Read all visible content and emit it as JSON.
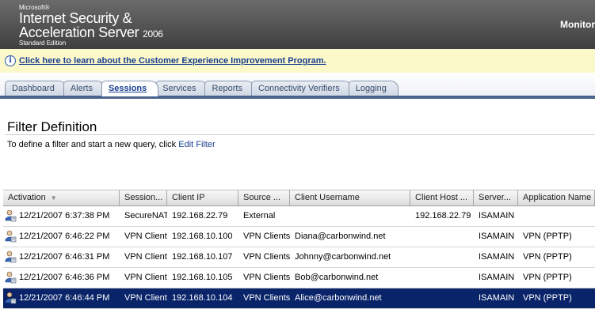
{
  "header": {
    "ms": "Microsoft®",
    "line1": "Internet Security &",
    "line2": "Acceleration Server",
    "year": "2006",
    "edition": "Standard Edition",
    "section": "Monitor"
  },
  "infobar": {
    "icon": "info-icon",
    "link": "Click here to learn about the Customer Experience Improvement Program."
  },
  "tabs": [
    {
      "label": "Dashboard",
      "active": false
    },
    {
      "label": "Alerts",
      "active": false
    },
    {
      "label": "Sessions",
      "active": true
    },
    {
      "label": "Services",
      "active": false
    },
    {
      "label": "Reports",
      "active": false
    },
    {
      "label": "Connectivity Verifiers",
      "active": false
    },
    {
      "label": "Logging",
      "active": false
    }
  ],
  "filter": {
    "title": "Filter Definition",
    "desc": "To define a filter and start a new query, click ",
    "link": "Edit Filter"
  },
  "table": {
    "columns": [
      "Activation",
      "Session...",
      "Client IP",
      "Source ...",
      "Client Username",
      "Client Host ...",
      "Server...",
      "Application Name"
    ],
    "rows": [
      {
        "selected": false,
        "cells": [
          "12/21/2007 6:37:38 PM",
          "SecureNAT",
          "192.168.22.79",
          "External",
          "",
          "192.168.22.79",
          "ISAMAIN",
          ""
        ]
      },
      {
        "selected": false,
        "cells": [
          "12/21/2007 6:46:22 PM",
          "VPN Client",
          "192.168.10.100",
          "VPN Clients",
          "Diana@carbonwind.net",
          "",
          "ISAMAIN",
          "VPN (PPTP)"
        ]
      },
      {
        "selected": false,
        "cells": [
          "12/21/2007 6:46:31 PM",
          "VPN Client",
          "192.168.10.107",
          "VPN Clients",
          "Johnny@carbonwind.net",
          "",
          "ISAMAIN",
          "VPN (PPTP)"
        ]
      },
      {
        "selected": false,
        "cells": [
          "12/21/2007 6:46:36 PM",
          "VPN Client",
          "192.168.10.105",
          "VPN Clients",
          "Bob@carbonwind.net",
          "",
          "ISAMAIN",
          "VPN (PPTP)"
        ]
      },
      {
        "selected": true,
        "cells": [
          "12/21/2007 6:46:44 PM",
          "VPN Client",
          "192.168.10.104",
          "VPN Clients",
          "Alice@carbonwind.net",
          "",
          "ISAMAIN",
          "VPN (PPTP)"
        ]
      }
    ]
  },
  "colors": {
    "header": "#555555",
    "infobar": "#fbf8c9",
    "link": "#1a3f8f",
    "selection": "#0a246a",
    "tabline": "#4a648f"
  }
}
